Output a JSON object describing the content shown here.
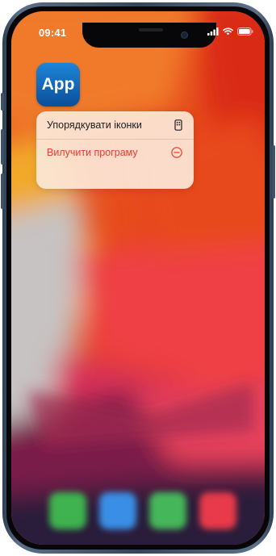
{
  "status_bar": {
    "time": "09:41",
    "icons": [
      "cellular-signal-icon",
      "wifi-icon",
      "battery-icon"
    ]
  },
  "app": {
    "label": "App",
    "icon_color_top": "#1e84d8",
    "icon_color_bottom": "#0a4f9a"
  },
  "context_menu": {
    "items": [
      {
        "label": "Упорядкувати іконки",
        "icon": "phone-screen-icon",
        "color": "#1c1c1e"
      },
      {
        "label": "Вилучити програму",
        "icon": "minus-circle-icon",
        "color": "#ef3b2d"
      }
    ]
  },
  "dock": {
    "apps": [
      "phone-app-icon",
      "safari-app-icon",
      "messages-app-icon",
      "music-app-icon"
    ]
  },
  "colors": {
    "frame": "#34465b",
    "destructive": "#ef3b2d",
    "menu_background": "#fce6d6"
  }
}
